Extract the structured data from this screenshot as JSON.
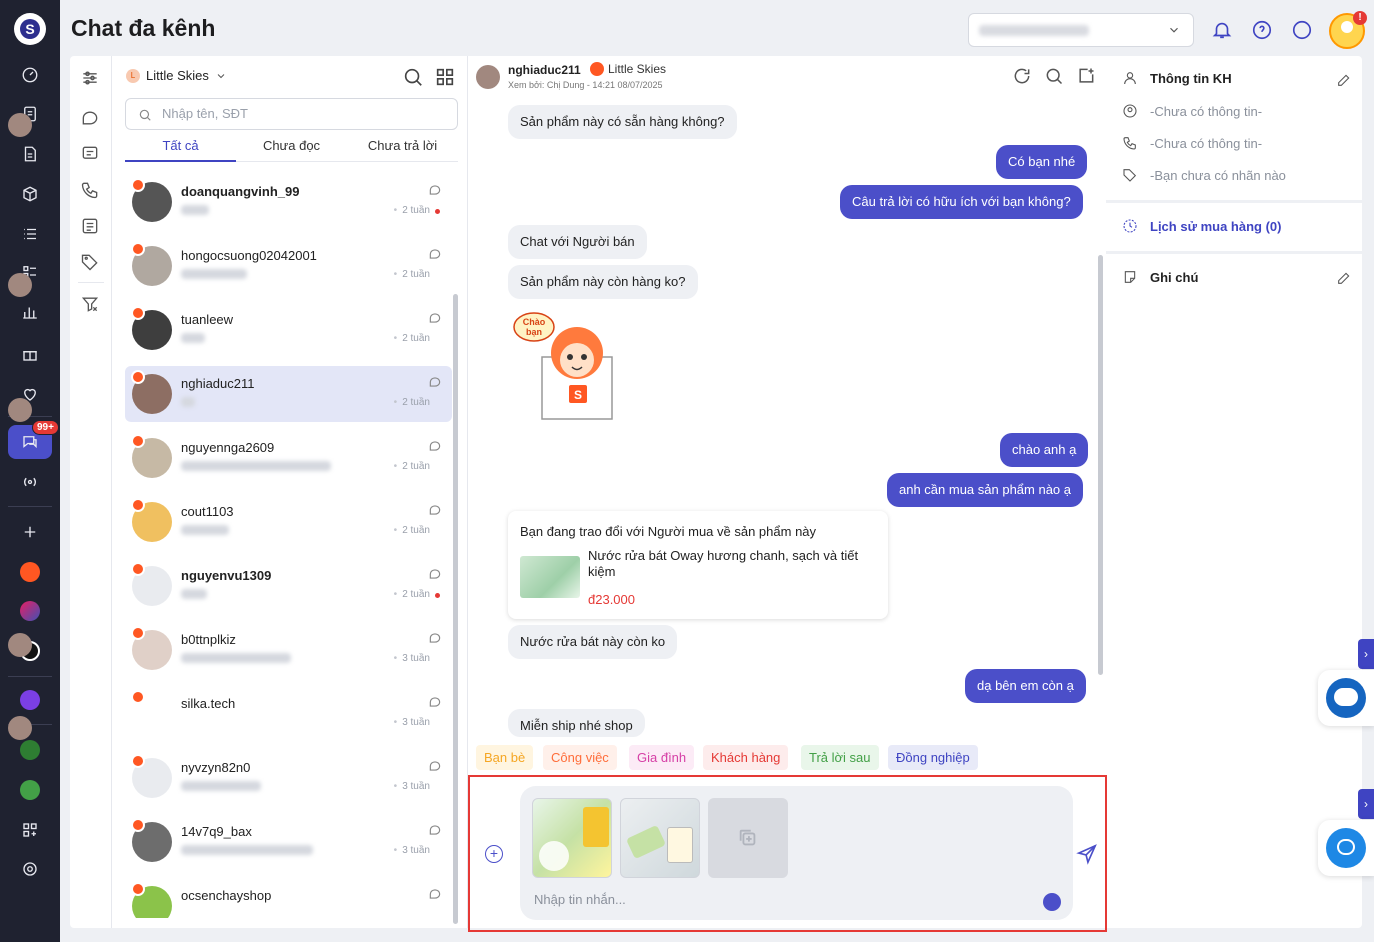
{
  "header": {
    "title": "Chat đa kênh"
  },
  "rail": {
    "badge": "99+"
  },
  "user": {
    "alert": "!"
  },
  "conv_list": {
    "shop_name": "Little Skies",
    "shop_initial": "L",
    "search_placeholder": "Nhập tên, SĐT",
    "tabs": [
      "Tất cả",
      "Chưa đọc",
      "Chưa trả lời"
    ],
    "items": [
      {
        "name": "doanquangvinh_99",
        "time": "2 tuần",
        "bold": true,
        "unread": true
      },
      {
        "name": "hongocsuong02042001",
        "time": "2 tuần",
        "bold": false,
        "unread": false
      },
      {
        "name": "tuanleew",
        "time": "2 tuần",
        "bold": false,
        "unread": false
      },
      {
        "name": "nghiaduc211",
        "time": "2 tuần",
        "bold": false,
        "unread": false,
        "selected": true
      },
      {
        "name": "nguyennga2609",
        "time": "2 tuần",
        "bold": false,
        "unread": false
      },
      {
        "name": "cout1103",
        "time": "2 tuần",
        "bold": false,
        "unread": false
      },
      {
        "name": "nguyenvu1309",
        "time": "2 tuần",
        "bold": true,
        "unread": true
      },
      {
        "name": "b0ttnplkiz",
        "time": "3 tuần",
        "bold": false,
        "unread": false
      },
      {
        "name": "silka.tech",
        "time": "3 tuần",
        "bold": false,
        "unread": false
      },
      {
        "name": "nyvzyn82n0",
        "time": "3 tuần",
        "bold": false,
        "unread": false
      },
      {
        "name": "14v7q9_bax",
        "time": "3 tuần",
        "bold": false,
        "unread": false
      },
      {
        "name": "ocsenchayshop",
        "time": "",
        "bold": false,
        "unread": false
      }
    ]
  },
  "chat": {
    "username": "nghiaduc211",
    "shop": "Little Skies",
    "seen_by": "Xem bởi: Chị Dung - 14:21 08/07/2025",
    "messages": {
      "m1": "Sản phẩm này có sẵn hàng không?",
      "m2": "Có bạn nhé",
      "m3": "Câu trả lời có hữu ích với bạn không?",
      "m4": "Chat với Người bán",
      "m5": "Sản phẩm này còn hàng ko?",
      "m6": "chào anh ạ",
      "m7": "anh cần mua sản phẩm nào ạ",
      "m8": "Nước rửa bát này còn ko",
      "m9": "dạ bên em còn ạ",
      "m10": "Miễn ship nhé shop"
    },
    "sticker": {
      "label": "Chào bạn",
      "bag_letter": "S"
    },
    "product_card": {
      "title": "Bạn đang trao đổi với Người mua về sản phẩm này",
      "name": "Nước rửa bát Oway hương chanh, sạch và tiết kiệm",
      "price": "đ23.000"
    },
    "tags": [
      {
        "label": "Bạn bè",
        "color": "#f5a623",
        "bg": "#fff5e0"
      },
      {
        "label": "Công việc",
        "color": "#ff6d3a",
        "bg": "#fff0ea"
      },
      {
        "label": "Gia đình",
        "color": "#d63fa6",
        "bg": "#fcebf6"
      },
      {
        "label": "Khách hàng",
        "color": "#e53935",
        "bg": "#fdecec"
      },
      {
        "label": "Trả lời sau",
        "color": "#43a047",
        "bg": "#e9f6ea"
      },
      {
        "label": "Đồng nghiệp",
        "color": "#3f44c2",
        "bg": "#e8eaf8"
      }
    ],
    "composer_placeholder": "Nhập tin nhắn..."
  },
  "customer": {
    "title": "Thông tin KH",
    "no_info_1": "-Chưa có thông tin-",
    "no_info_2": "-Chưa có thông tin-",
    "no_label": "-Bạn chưa có nhãn nào",
    "history": "Lịch sử mua hàng (0)",
    "notes": "Ghi chú"
  }
}
